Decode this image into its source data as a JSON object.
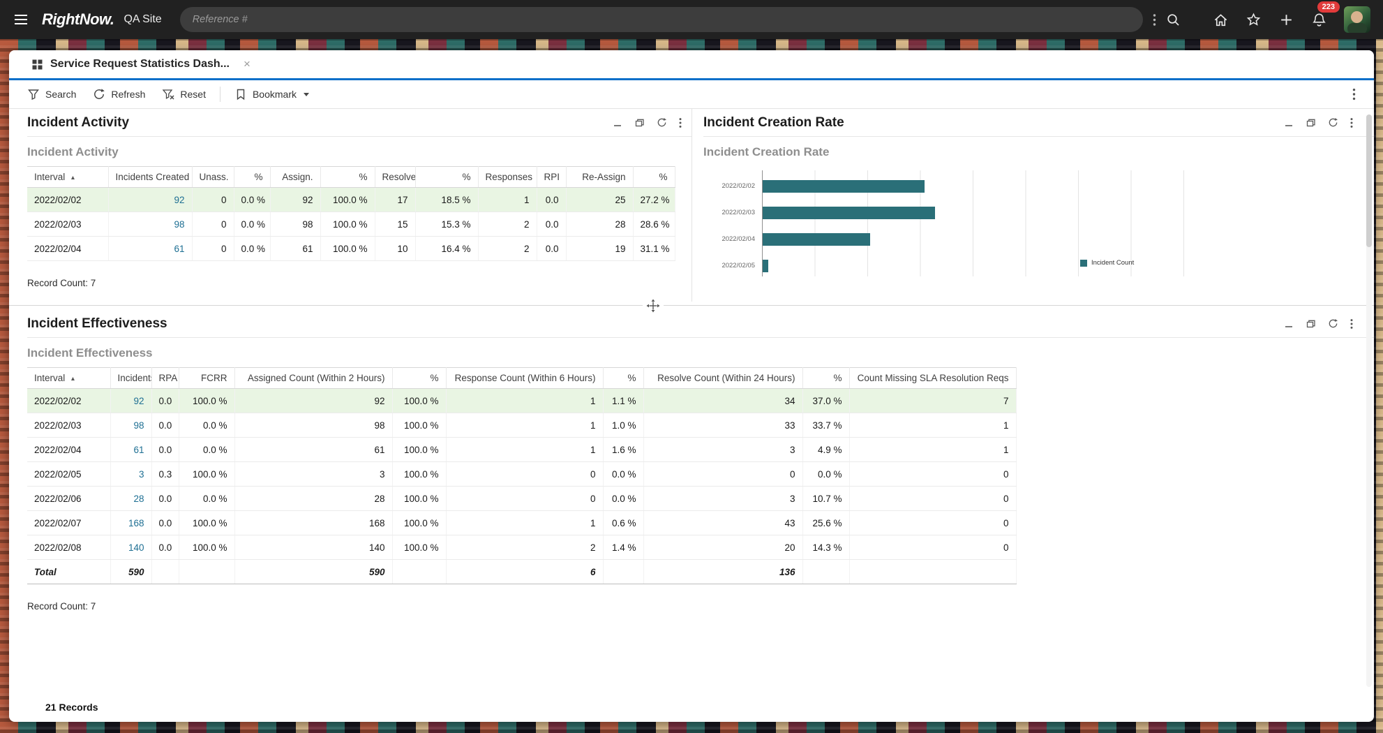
{
  "colors": {
    "accent_blue": "#0b6fc9",
    "bar_teal": "#2a6f78",
    "link_blue": "#1e6f93",
    "row_highlight_green": "#e9f5e3",
    "badge_red": "#e23b3b",
    "topbar_dark": "#212121"
  },
  "topbar": {
    "logo": "RightNow.",
    "site_label": "QA Site",
    "search_placeholder": "Reference #",
    "notification_count": "223"
  },
  "tab": {
    "label": "Service Request Statistics Dash...",
    "close_glyph": "×"
  },
  "toolbar": {
    "search_label": "Search",
    "refresh_label": "Refresh",
    "reset_label": "Reset",
    "bookmark_label": "Bookmark"
  },
  "icons": {
    "sort_asc": "▲"
  },
  "activity": {
    "title": "Incident Activity",
    "subtitle": "Incident Activity",
    "columns": [
      "Interval",
      "Incidents Created",
      "Unass.",
      "%",
      "Assign.",
      "%",
      "Resolved",
      "%",
      "Responses",
      "RPI",
      "Re-Assign",
      "%"
    ],
    "rows": [
      [
        "2022/02/02",
        "92",
        "0",
        "0.0 %",
        "92",
        "100.0 %",
        "17",
        "18.5 %",
        "1",
        "0.0",
        "25",
        "27.2 %"
      ],
      [
        "2022/02/03",
        "98",
        "0",
        "0.0 %",
        "98",
        "100.0 %",
        "15",
        "15.3 %",
        "2",
        "0.0",
        "28",
        "28.6 %"
      ],
      [
        "2022/02/04",
        "61",
        "0",
        "0.0 %",
        "61",
        "100.0 %",
        "10",
        "16.4 %",
        "2",
        "0.0",
        "19",
        "31.1 %"
      ]
    ],
    "record_count": "Record Count: 7"
  },
  "creation_rate": {
    "title": "Incident Creation Rate",
    "subtitle": "Incident Creation Rate"
  },
  "chart_data": {
    "type": "bar",
    "orientation": "horizontal",
    "title": "Incident Creation Rate",
    "categories": [
      "2022/02/02",
      "2022/02/03",
      "2022/02/04",
      "2022/02/05"
    ],
    "series": [
      {
        "name": "Incident Count",
        "values": [
          92,
          98,
          61,
          3
        ]
      }
    ],
    "xlim": [
      0,
      240
    ],
    "gridline_step": 30,
    "grid": true,
    "legend_position": "bottom-right",
    "bar_color": "#2a6f78"
  },
  "effectiveness": {
    "title": "Incident Effectiveness",
    "subtitle": "Incident Effectiveness",
    "columns": [
      "Interval",
      "Incidents",
      "RPA",
      "FCRR",
      "Assigned Count (Within 2 Hours)",
      "%",
      "Response Count (Within 6 Hours)",
      "%",
      "Resolve Count (Within 24 Hours)",
      "%",
      "Count Missing SLA Resolution Reqs"
    ],
    "rows": [
      [
        "2022/02/02",
        "92",
        "0.0",
        "100.0 %",
        "92",
        "100.0 %",
        "1",
        "1.1 %",
        "34",
        "37.0 %",
        "7"
      ],
      [
        "2022/02/03",
        "98",
        "0.0",
        "0.0 %",
        "98",
        "100.0 %",
        "1",
        "1.0 %",
        "33",
        "33.7 %",
        "1"
      ],
      [
        "2022/02/04",
        "61",
        "0.0",
        "0.0 %",
        "61",
        "100.0 %",
        "1",
        "1.6 %",
        "3",
        "4.9 %",
        "1"
      ],
      [
        "2022/02/05",
        "3",
        "0.3",
        "100.0 %",
        "3",
        "100.0 %",
        "0",
        "0.0 %",
        "0",
        "0.0 %",
        "0"
      ],
      [
        "2022/02/06",
        "28",
        "0.0",
        "0.0 %",
        "28",
        "100.0 %",
        "0",
        "0.0 %",
        "3",
        "10.7 %",
        "0"
      ],
      [
        "2022/02/07",
        "168",
        "0.0",
        "100.0 %",
        "168",
        "100.0 %",
        "1",
        "0.6 %",
        "43",
        "25.6 %",
        "0"
      ],
      [
        "2022/02/08",
        "140",
        "0.0",
        "100.0 %",
        "140",
        "100.0 %",
        "2",
        "1.4 %",
        "20",
        "14.3 %",
        "0"
      ]
    ],
    "total": [
      "Total",
      "590",
      "",
      "",
      "590",
      "",
      "6",
      "",
      "136",
      "",
      ""
    ],
    "record_count": "Record Count: 7"
  },
  "statusbar": {
    "text": "21 Records"
  }
}
